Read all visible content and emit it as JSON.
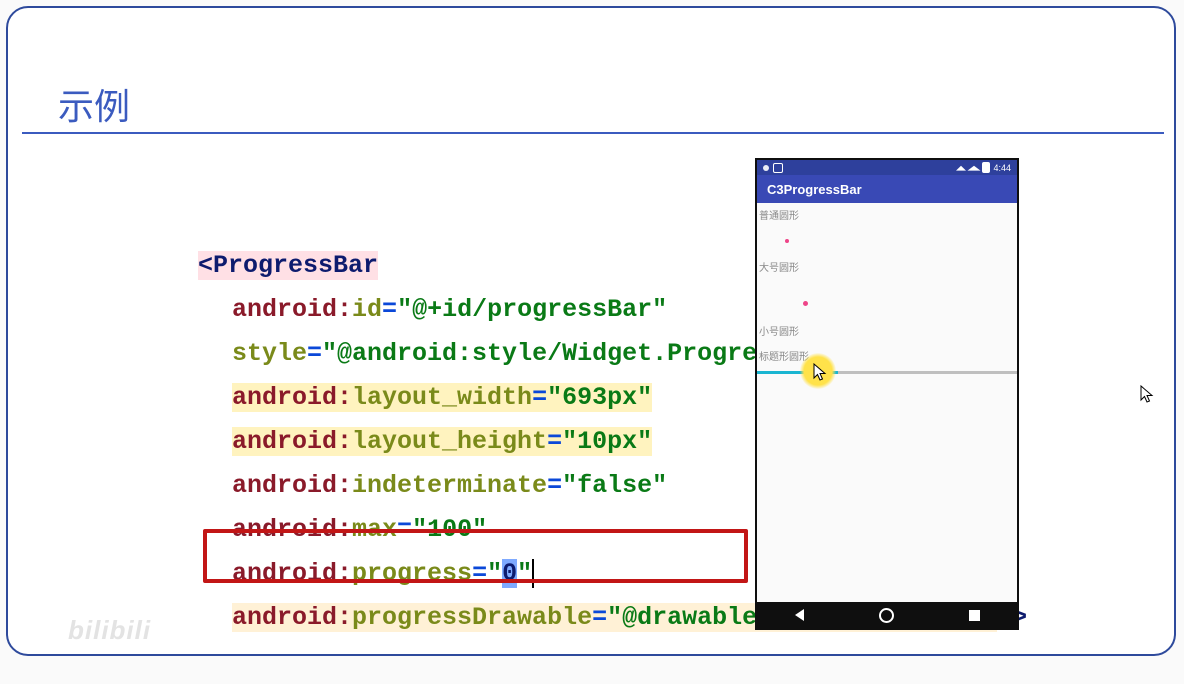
{
  "slide": {
    "title": "示例"
  },
  "code": {
    "tag_open": "<ProgressBar",
    "tag_close": "/>",
    "attrs": {
      "id_ns": "android:",
      "id_name": "id",
      "id_eq": "=",
      "id_val": "\"@+id/progressBar\"",
      "style_name": "style",
      "style_eq": "=",
      "style_val": "\"@android:style/Widget.ProgressBar.Horizontal\"",
      "lw_ns": "android:",
      "lw_name": "layout_width",
      "lw_eq": "=",
      "lw_val": "\"693px\"",
      "lh_ns": "android:",
      "lh_name": "layout_height",
      "lh_eq": "=",
      "lh_val": "\"10px\"",
      "ind_ns": "android:",
      "ind_name": "indeterminate",
      "ind_eq": "=",
      "ind_val": "\"false\"",
      "max_ns": "android:",
      "max_name": "max",
      "max_eq": "=",
      "max_val": "\"100\"",
      "prog_ns": "android:",
      "prog_name": "progress",
      "prog_eq": "=",
      "prog_q1": "\"",
      "prog_zero": "0",
      "prog_q2": "\"",
      "pd_ns": "android:",
      "pd_name": "progressDrawable",
      "pd_eq": "=",
      "pd_val": "\"@drawable/progress_shape\""
    }
  },
  "phone": {
    "time": "4:44",
    "app_title": "C3ProgressBar",
    "labels": {
      "l1": "普通圆形",
      "l2": "大号圆形",
      "l3": "小号圆形",
      "l4": "标题形圆形"
    },
    "progress_fill_percent": 31
  },
  "watermark": "bilibili"
}
